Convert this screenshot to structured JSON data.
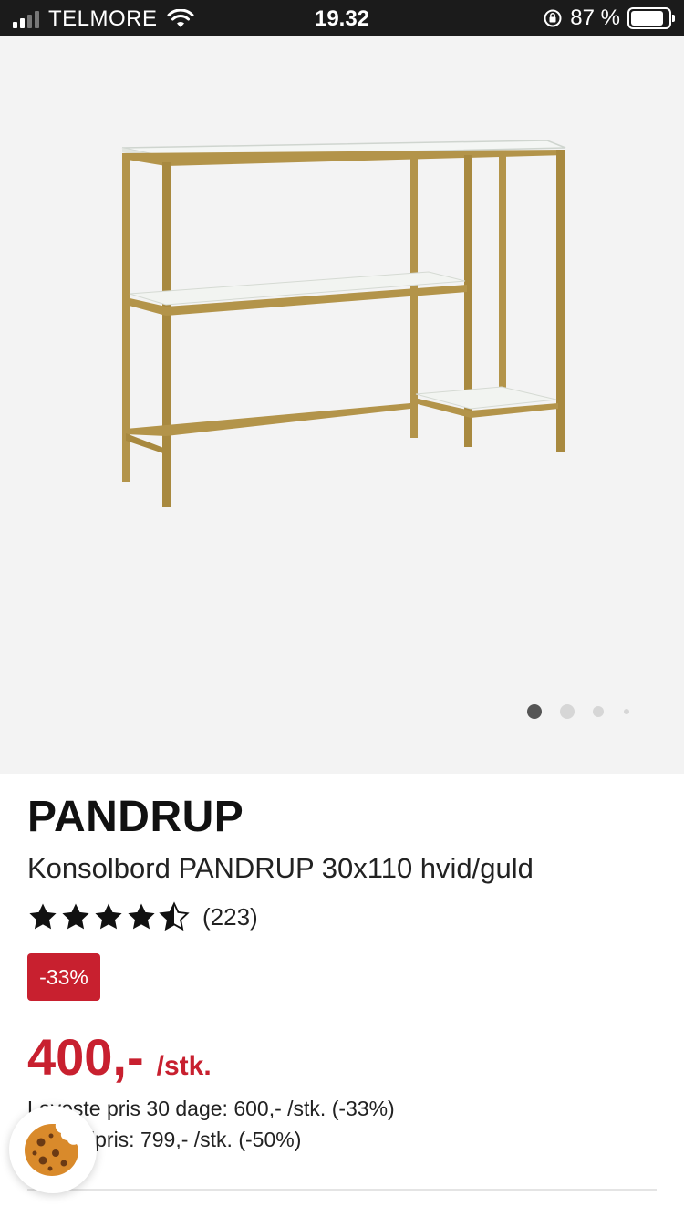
{
  "status_bar": {
    "carrier": "TELMORE",
    "time": "19.32",
    "battery_percent": "87 %"
  },
  "gallery": {
    "image_count": 4,
    "active_index": 0
  },
  "product": {
    "brand": "PANDRUP",
    "name": "Konsolbord PANDRUP 30x110 hvid/guld",
    "rating": 4.5,
    "rating_max": 5,
    "reviews": "(223)",
    "discount_badge": "-33%",
    "price": "400,-",
    "price_unit": "/stk.",
    "lowest_price_30": "Laveste pris 30 dage: 600,- /stk. (-33%)",
    "normal_price": "Normalpris: 799,- /stk. (-50%)"
  },
  "colors": {
    "accent_red": "#c8202f",
    "frame_gold": "#b3944a",
    "glass_white": "#f4f6f4"
  },
  "icons": {
    "cookie": "cookie-icon",
    "wifi": "wifi-icon",
    "battery": "battery-icon",
    "star": "star-icon"
  }
}
